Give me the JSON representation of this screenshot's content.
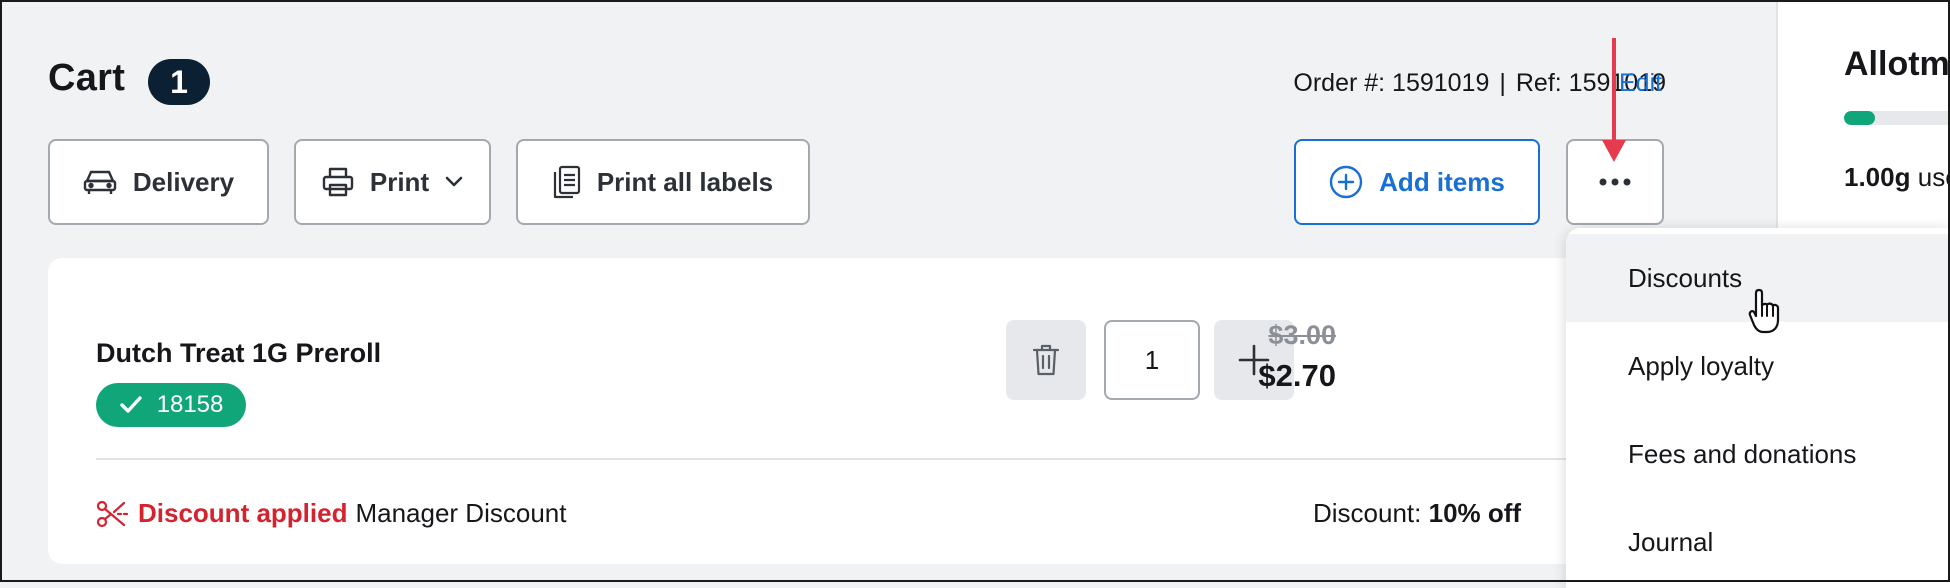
{
  "header": {
    "title": "Cart",
    "count": "1",
    "order_label": "Order #: 1591019",
    "separator": "|",
    "ref_label": "Ref: 1591019",
    "edit_label": "Edit"
  },
  "toolbar": {
    "delivery_label": "Delivery",
    "print_label": "Print",
    "print_all_labels": "Print all labels",
    "add_items_label": "Add items"
  },
  "cart_item": {
    "name": "Dutch Treat 1G Preroll",
    "sku": "18158",
    "quantity": "1",
    "original_price": "$3.00",
    "price": "$2.70",
    "discount_status": "Discount applied",
    "discount_name": "Manager Discount",
    "discount_label": "Discount:",
    "discount_value": "10% off"
  },
  "sidebar": {
    "title": "Allotment",
    "used_amount": "1.00g",
    "used_suffix": "used"
  },
  "menu": {
    "items": [
      "Discounts",
      "Apply loyalty",
      "Fees and donations",
      "Journal"
    ]
  },
  "colors": {
    "accent": "#1870d5",
    "success": "#11a679",
    "danger": "#d5222f",
    "annotation_arrow": "#e43b4e"
  }
}
